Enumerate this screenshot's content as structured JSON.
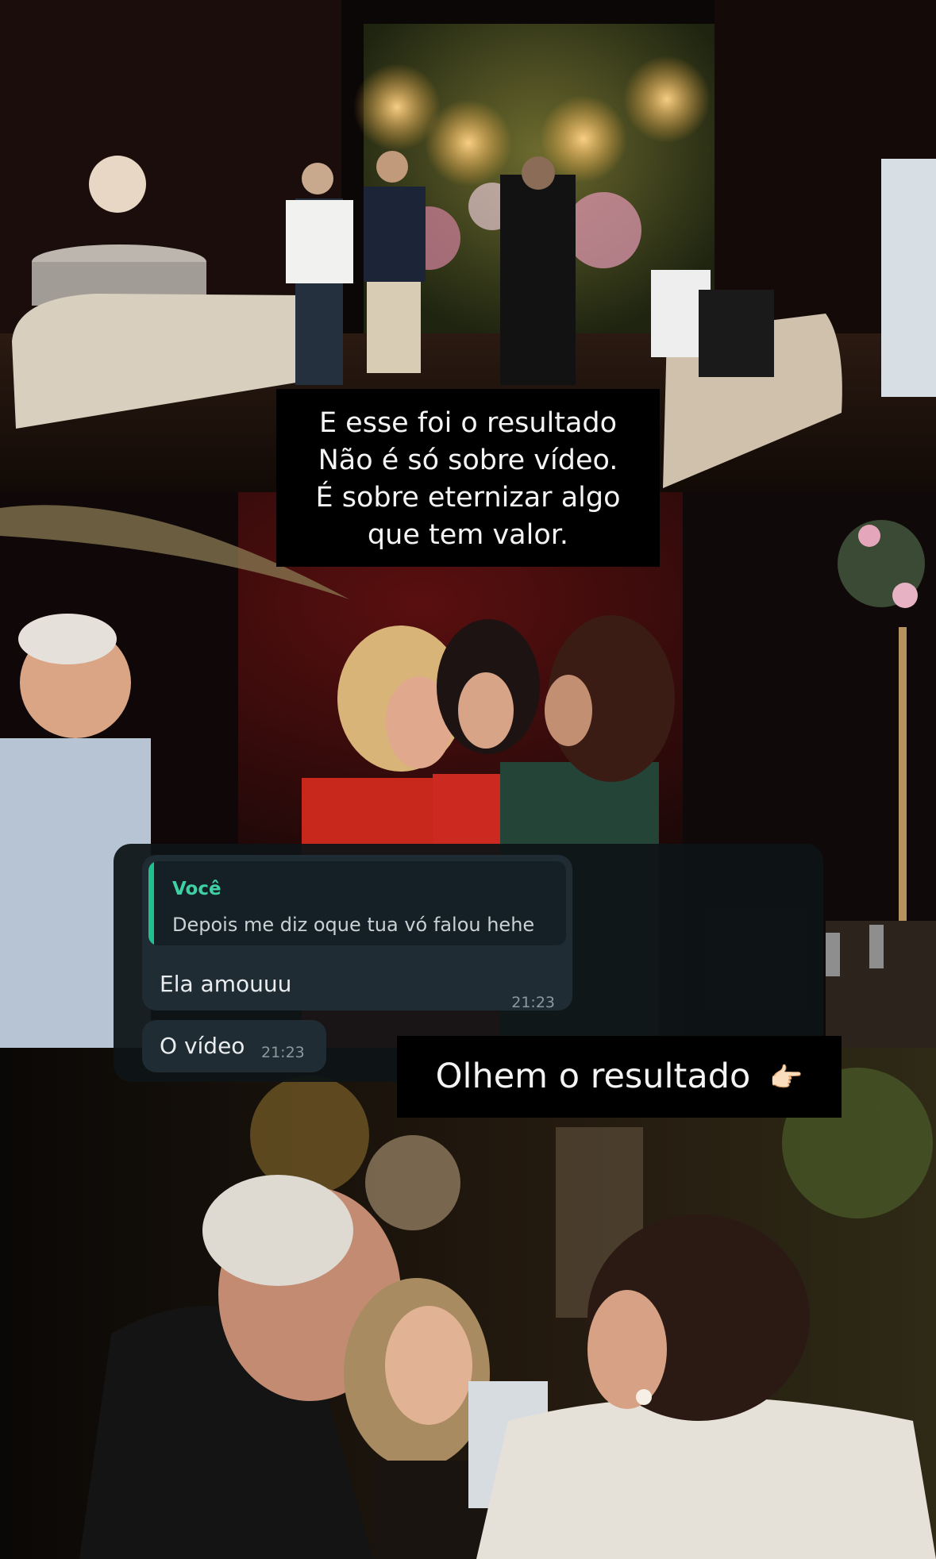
{
  "caption_top": {
    "lines": [
      "E esse foi o resultado",
      "Não é só sobre vídeo.",
      "É sobre eternizar algo",
      "que tem valor."
    ]
  },
  "chat": {
    "quoted_message": {
      "author": "Você",
      "text": "Depois me diz oque tua vó falou hehe"
    },
    "messages": [
      {
        "text": "Ela amouuu",
        "time": "21:23"
      },
      {
        "text": "O vídeo",
        "time": "21:23"
      }
    ],
    "colors": {
      "accent": "#21c18d",
      "bubble": "#1f2c33"
    }
  },
  "caption_result": {
    "text": "Olhem o resultado",
    "emoji": "👉🏻",
    "emoji_icon": "pointing-right-hand-icon"
  }
}
